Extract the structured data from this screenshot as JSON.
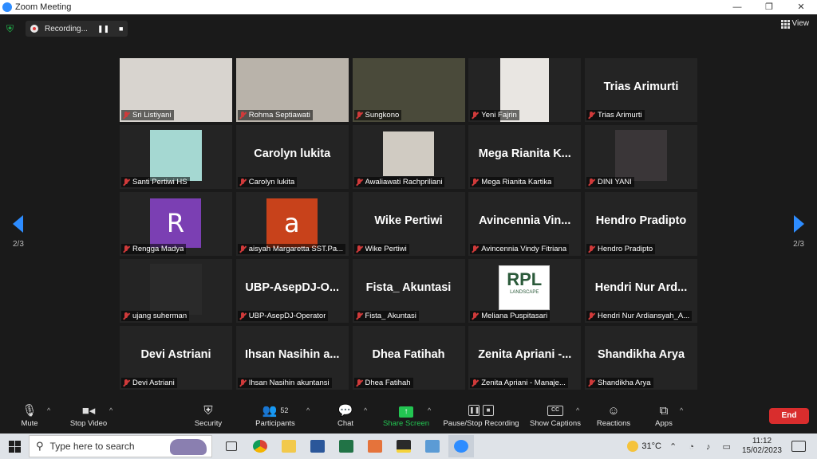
{
  "window": {
    "title": "Zoom Meeting"
  },
  "recording": {
    "label": "Recording..."
  },
  "view": {
    "label": "View"
  },
  "pagination": {
    "current": "2/3"
  },
  "participants": [
    {
      "name": "Sri Listiyani",
      "display": "photo",
      "color": "#d8d4cf"
    },
    {
      "name": "Rohma Septiawati",
      "display": "photo",
      "color": "#b9b3aa"
    },
    {
      "name": "Sungkono",
      "display": "photo",
      "color": "#4a4a3a"
    },
    {
      "name": "Yeni Fajrin",
      "display": "photo",
      "color": "#e9e6e2"
    },
    {
      "name": "Trias Arimurti",
      "display": "name",
      "big": "Trias Arimurti"
    },
    {
      "name": "Santi Pertiwi HS",
      "display": "photo",
      "color": "#a5d8d2"
    },
    {
      "name": "Carolyn lukita",
      "display": "name",
      "big": "Carolyn lukita"
    },
    {
      "name": "Awaliawati Rachpriliani",
      "display": "photo",
      "color": "#d0cbc2"
    },
    {
      "name": "Mega Rianita Kartika",
      "display": "name",
      "big": "Mega Rianita K..."
    },
    {
      "name": "DINI YANI",
      "display": "photo",
      "color": "#3a3638"
    },
    {
      "name": "Rengga Madya",
      "display": "letter",
      "letter": "R",
      "color": "#7b3fb3"
    },
    {
      "name": "aisyah Margaretta SST.Pa...",
      "display": "letter",
      "letter": "a",
      "color": "#c8421b"
    },
    {
      "name": "Wike Pertiwi",
      "display": "name",
      "big": "Wike Pertiwi"
    },
    {
      "name": "Avincennia Vindy Fitriana",
      "display": "name",
      "big": "Avincennia Vin..."
    },
    {
      "name": "Hendro Pradipto",
      "display": "name",
      "big": "Hendro Pradipto"
    },
    {
      "name": "ujang suherman",
      "display": "photo",
      "color": "#2a2a2a"
    },
    {
      "name": "UBP-AsepDJ-Operator",
      "display": "name",
      "big": "UBP-AsepDJ-O..."
    },
    {
      "name": "Fista_ Akuntasi",
      "display": "name",
      "big": "Fista_ Akuntasi"
    },
    {
      "name": "Meliana Puspitasari",
      "display": "logo",
      "logo_text": "RPL",
      "logo_sub": "LANDSCAPE"
    },
    {
      "name": "Hendri Nur Ardiansyah_A...",
      "display": "name",
      "big": "Hendri Nur Ard..."
    },
    {
      "name": "Devi Astriani",
      "display": "name",
      "big": "Devi Astriani"
    },
    {
      "name": "Ihsan Nasihin akuntansi",
      "display": "name",
      "big": "Ihsan Nasihin a..."
    },
    {
      "name": "Dhea Fatihah",
      "display": "name",
      "big": "Dhea Fatihah"
    },
    {
      "name": "Zenita Apriani - Manaje...",
      "display": "name",
      "big": "Zenita Apriani -..."
    },
    {
      "name": "Shandikha Arya",
      "display": "name",
      "big": "Shandikha Arya"
    }
  ],
  "toolbar": {
    "mute": "Mute",
    "stop_video": "Stop Video",
    "security": "Security",
    "participants": "Participants",
    "participants_count": "52",
    "chat": "Chat",
    "share_screen": "Share Screen",
    "pause_stop": "Pause/Stop Recording",
    "captions": "Show Captions",
    "cc": "CC",
    "reactions": "Reactions",
    "apps": "Apps",
    "end": "End"
  },
  "taskbar": {
    "search_placeholder": "Type here to search",
    "temperature": "31°C",
    "time": "11:12",
    "date": "15/02/2023"
  }
}
